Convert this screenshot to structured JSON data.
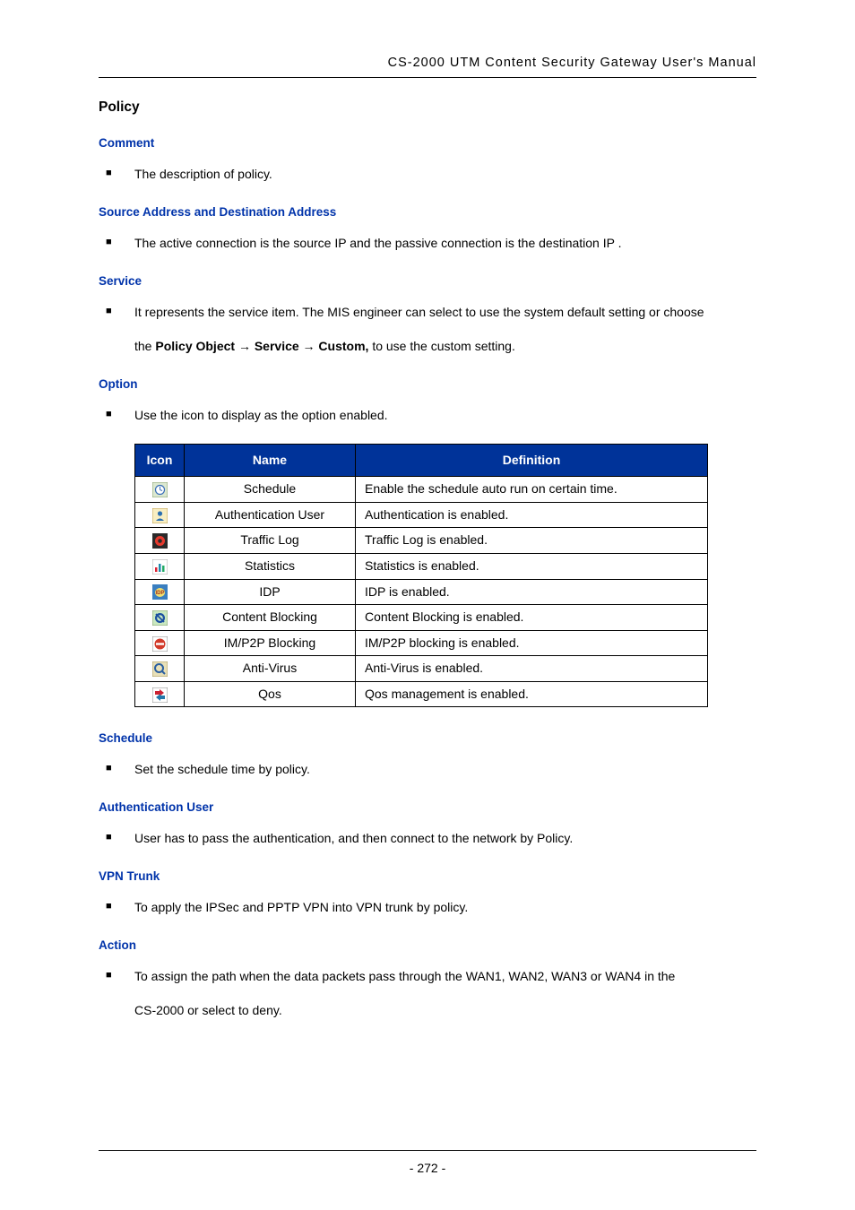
{
  "header": {
    "running_head": "CS-2000 UTM Content Security Gateway User's Manual"
  },
  "title": "Policy",
  "sections": {
    "comment": {
      "heading": "Comment",
      "items": [
        "The description of policy."
      ]
    },
    "source_dest": {
      "heading": "Source Address and Destination Address",
      "items": [
        "The active connection is the source IP and the passive connection is the destination IP ."
      ]
    },
    "service": {
      "heading": "Service",
      "line1": "It represents the service item. The MIS engineer can select to use the system default setting or choose",
      "line2_prefix": "the ",
      "line2_bold1": "Policy Object → Service → Custom,",
      "line2_tail": " to use the custom setting."
    },
    "option": {
      "heading": "Option",
      "items": [
        "Use the icon to display as the option enabled."
      ]
    },
    "table": {
      "headers": {
        "icon": "Icon",
        "name": "Name",
        "definition": "Definition"
      },
      "rows": [
        {
          "icon": "schedule-icon",
          "name": "Schedule",
          "definition": "Enable the schedule auto run on certain time."
        },
        {
          "icon": "auth-user-icon",
          "name": "Authentication User",
          "definition": "Authentication is enabled."
        },
        {
          "icon": "traffic-log-icon",
          "name": "Traffic Log",
          "definition": "Traffic Log is enabled."
        },
        {
          "icon": "statistics-icon",
          "name": "Statistics",
          "definition": "Statistics is enabled."
        },
        {
          "icon": "idp-icon",
          "name": "IDP",
          "definition": "IDP is enabled."
        },
        {
          "icon": "content-block-icon",
          "name": "Content Blocking",
          "definition": "Content Blocking is enabled."
        },
        {
          "icon": "imp2p-block-icon",
          "name": "IM/P2P Blocking",
          "definition": "IM/P2P blocking is enabled."
        },
        {
          "icon": "antivirus-icon",
          "name": "Anti-Virus",
          "definition": "Anti-Virus is enabled."
        },
        {
          "icon": "qos-icon",
          "name": "Qos",
          "definition": "Qos management is enabled."
        }
      ]
    },
    "schedule": {
      "heading": "Schedule",
      "items": [
        "Set the schedule time by policy."
      ]
    },
    "auth_user": {
      "heading": "Authentication User",
      "items": [
        "User has to pass the authentication, and then connect to the network by Policy."
      ]
    },
    "vpn_trunk": {
      "heading": "VPN Trunk",
      "items": [
        "To apply the IPSec and PPTP VPN into VPN trunk by policy."
      ]
    },
    "action": {
      "heading": "Action",
      "line1": "To assign the path when the data packets pass through the WAN1, WAN2, WAN3 or WAN4 in the",
      "line2": "CS-2000 or select to deny."
    }
  },
  "footer": {
    "page_number": "- 272 -"
  }
}
